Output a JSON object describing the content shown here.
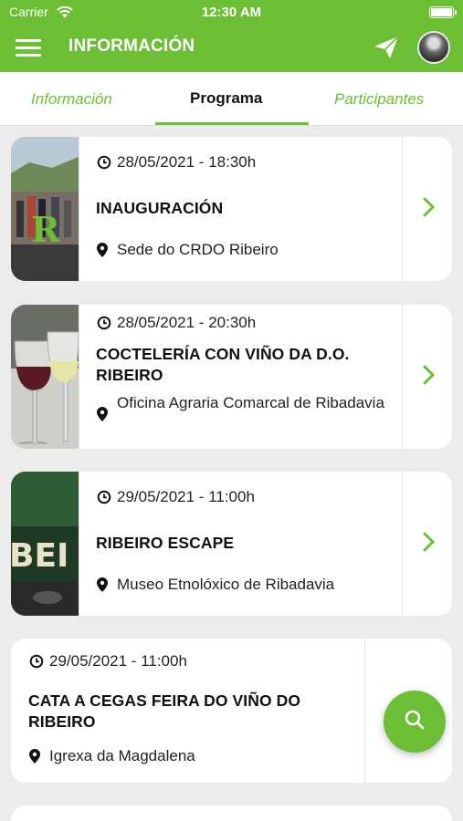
{
  "status_bar": {
    "carrier": "Carrier",
    "time": "12:30 AM"
  },
  "header": {
    "title": "INFORMACIÓN"
  },
  "tabs": [
    {
      "label": "Información",
      "active": false
    },
    {
      "label": "Programa",
      "active": true
    },
    {
      "label": "Participantes",
      "active": false
    }
  ],
  "colors": {
    "accent": "#6cbe35",
    "background": "#ececec"
  },
  "events": [
    {
      "datetime": "28/05/2021 - 18:30h",
      "title": "INAUGURACIÓN",
      "location": "Sede do CRDO Ribeiro",
      "has_image": true
    },
    {
      "datetime": "28/05/2021 - 20:30h",
      "title": "COCTELERÍA CON VIÑO DA D.O. RIBEIRO",
      "location": "Oficina Agraria Comarcal de Ribadavia",
      "has_image": true
    },
    {
      "datetime": "29/05/2021 - 11:00h",
      "title": "RIBEIRO ESCAPE",
      "location": "Museo Etnolóxico de Ribadavia",
      "has_image": true
    },
    {
      "datetime": "29/05/2021 - 11:00h",
      "title": "CATA A CEGAS FEIRA DO VIÑO DO RIBEIRO",
      "location": "Igrexa da Magdalena",
      "has_image": false
    }
  ],
  "icons": {
    "menu": "hamburger-icon",
    "send": "paper-plane-icon",
    "search": "search-icon",
    "clock": "clock-icon",
    "pin": "location-pin-icon",
    "chevron": "chevron-right-icon"
  }
}
